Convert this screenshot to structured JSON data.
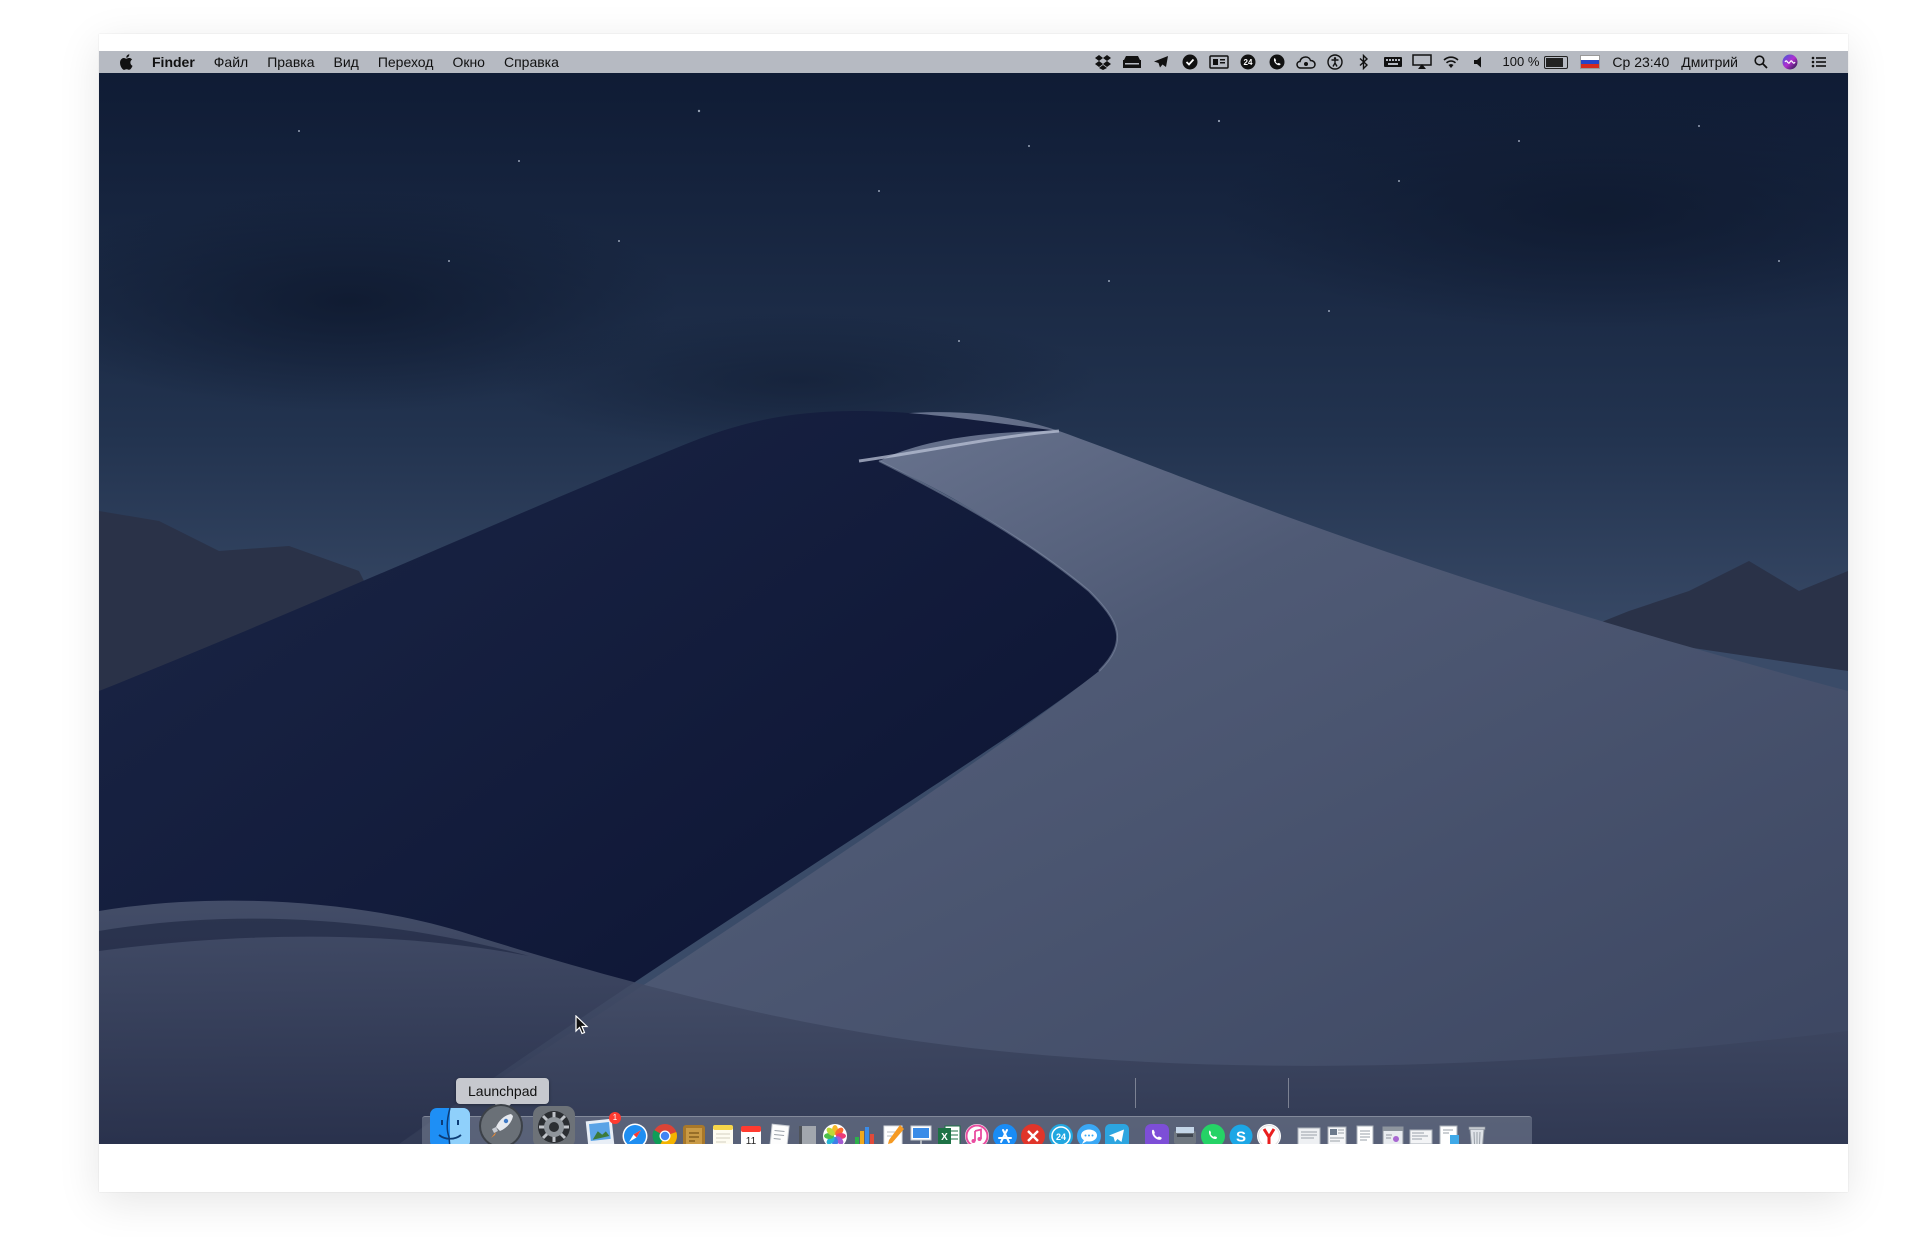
{
  "menubar": {
    "app_name": "Finder",
    "menus": [
      "Файл",
      "Правка",
      "Вид",
      "Переход",
      "Окно",
      "Справка"
    ],
    "status_icons": [
      "dropbox-icon",
      "scanner-icon",
      "telegram-icon",
      "check-icon",
      "screen-icon",
      "app24-icon",
      "viber-icon",
      "cloud-icon",
      "accessibility-icon",
      "bluetooth-icon",
      "keyboard-icon",
      "airplay-icon",
      "wifi-icon",
      "volume-icon"
    ],
    "battery_percent": "100 %",
    "battery_level": 1.0,
    "input_source": "russian-flag",
    "clock": "Ср 23:40",
    "user": "Дмитрий"
  },
  "dock": {
    "tooltip": "Launchpad",
    "apps": [
      {
        "name": "finder-icon",
        "running": true
      },
      {
        "name": "launchpad-icon",
        "running": false
      },
      {
        "name": "system-preferences-icon",
        "running": true
      },
      {
        "name": "preview-icon",
        "running": true,
        "badge": "1"
      },
      {
        "name": "safari-icon",
        "running": true
      },
      {
        "name": "chrome-icon",
        "running": false
      },
      {
        "name": "notes-brown-icon",
        "running": true
      },
      {
        "name": "notes-icon",
        "running": false
      },
      {
        "name": "calendar-icon",
        "running": true
      },
      {
        "name": "textedit-icon",
        "running": false
      },
      {
        "name": "book-icon",
        "running": false
      },
      {
        "name": "photos-icon",
        "running": true
      },
      {
        "name": "numbers-icon",
        "running": false
      },
      {
        "name": "pages-icon",
        "running": true
      },
      {
        "name": "keynote-icon",
        "running": false
      },
      {
        "name": "excel-icon",
        "running": true
      },
      {
        "name": "itunes-icon",
        "running": false
      },
      {
        "name": "app-store-icon",
        "running": false
      },
      {
        "name": "parallels-icon",
        "running": true
      },
      {
        "name": "app24-icon",
        "running": false
      },
      {
        "name": "messages-icon",
        "running": true
      },
      {
        "name": "telegram-icon",
        "running": true
      },
      {
        "name": "viber-icon",
        "running": true
      },
      {
        "name": "image-capture-icon",
        "running": true
      },
      {
        "name": "whatsapp-icon",
        "running": true
      },
      {
        "name": "skype-icon",
        "running": false
      },
      {
        "name": "yandex-browser-icon",
        "running": true
      },
      {
        "name": "document-stack-icon-1",
        "running": false
      },
      {
        "name": "document-stack-icon-2",
        "running": false
      },
      {
        "name": "document-stack-icon-3",
        "running": false
      },
      {
        "name": "document-stack-icon-4",
        "running": false
      },
      {
        "name": "document-stack-icon-5",
        "running": false
      },
      {
        "name": "document-stack-icon-6",
        "running": false
      },
      {
        "name": "trash-icon",
        "running": false
      }
    ]
  },
  "colors": {
    "sky_top": "#0e1a33",
    "sky_mid": "#2d3f5e",
    "dune_light": "#5b6680",
    "dune_dark": "#0c1430",
    "menubar_bg": "#b6bac2"
  }
}
